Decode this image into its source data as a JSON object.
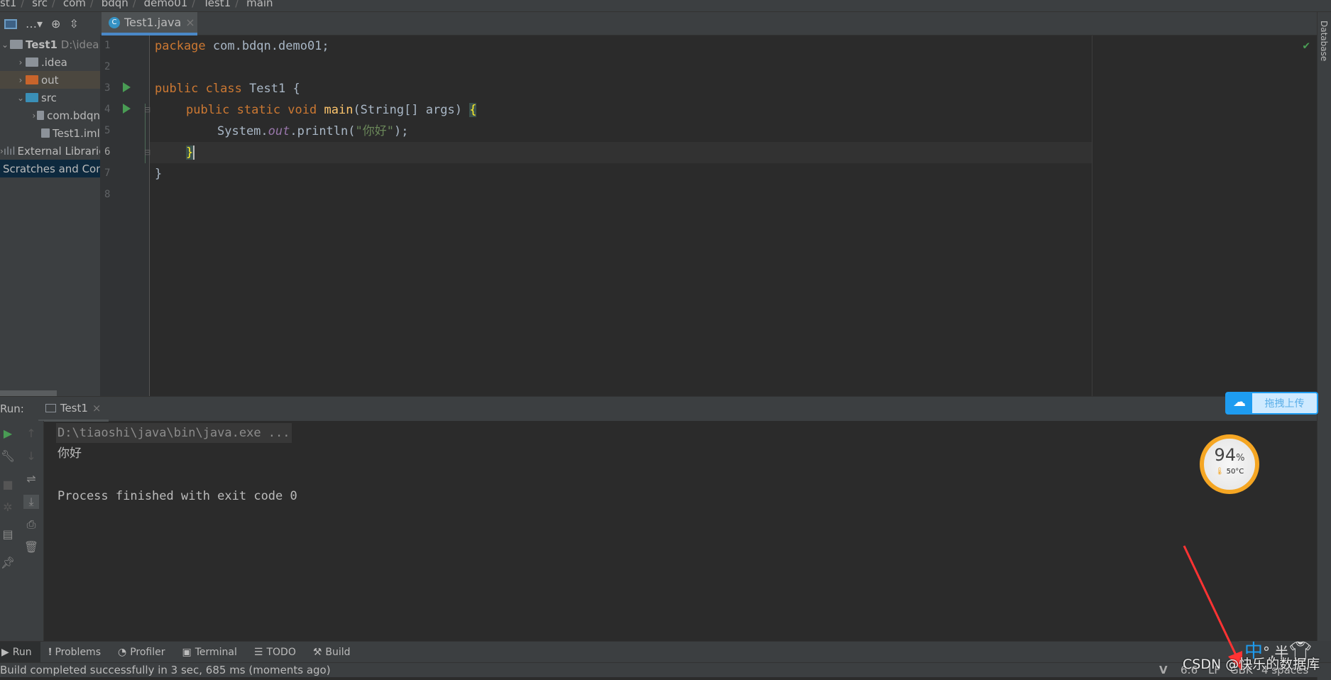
{
  "breadcrumb": [
    "st1",
    "src",
    "com",
    "bdqn",
    "demo01",
    "Test1",
    "main"
  ],
  "editor": {
    "tab_label": "Test1.java",
    "line_numbers": [
      "1",
      "2",
      "3",
      "4",
      "5",
      "6",
      "7",
      "8"
    ],
    "lines": {
      "l1_kw": "package",
      "l1_rest": " com.bdqn.demo01;",
      "l3_kw": "public class",
      "l3_rest": " Test1 {",
      "l4_kw": "public static void",
      "l4_fn": "main",
      "l4_rest": "(String[] args) ",
      "l4_brace": "{",
      "l5_a": "System.",
      "l5_fld": "out",
      "l5_b": ".println(",
      "l5_str": "\"你好\"",
      "l5_c": ");",
      "l6": "}",
      "l7": "}"
    }
  },
  "project": {
    "root_name": "Test1",
    "root_path": "D:\\idea",
    "items": [
      ".idea",
      "out",
      "src",
      "com.bdqn",
      "Test1.iml",
      "External Libraries",
      "Scratches and Consoles"
    ]
  },
  "right_strip": {
    "label": "Database"
  },
  "run": {
    "label": "Run:",
    "tab": "Test1",
    "output": [
      "D:\\tiaoshi\\java\\bin\\java.exe ...",
      "你好",
      "",
      "Process finished with exit code 0"
    ]
  },
  "bottom_tabs": [
    "Run",
    "Problems",
    "Profiler",
    "Terminal",
    "TODO",
    "Build"
  ],
  "status": {
    "message": "Build completed successfully in 3 sec, 685 ms (moments ago)",
    "position": "6:6",
    "line_sep": "LF",
    "encoding": "GBK",
    "indent": "4 spaces"
  },
  "overlay": {
    "upload_label": "拖拽上传",
    "cpu_percent": "94",
    "percent_sign": "%",
    "temperature": "50°C",
    "ime": "中",
    "ime_extra": "°,半",
    "watermark": "CSDN @快乐的数据库"
  },
  "colors": {
    "accent": "#4a88c7",
    "run_green": "#499c54",
    "gauge": "#f5a623",
    "arrow": "#ff3333"
  }
}
